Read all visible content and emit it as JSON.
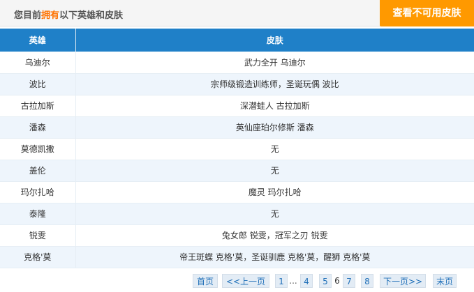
{
  "header": {
    "title_pre": "您目前",
    "title_highlight": "拥有",
    "title_post": "以下英雄和皮肤",
    "cta_label": "查看不可用皮肤"
  },
  "table": {
    "columns": [
      "英雄",
      "皮肤"
    ],
    "rows": [
      {
        "hero": "乌迪尔",
        "skins": "武力全开 乌迪尔"
      },
      {
        "hero": "波比",
        "skins": "宗师级锻造训练师，圣诞玩偶 波比"
      },
      {
        "hero": "古拉加斯",
        "skins": "深潜蛙人 古拉加斯"
      },
      {
        "hero": "潘森",
        "skins": "英仙座珀尔修斯 潘森"
      },
      {
        "hero": "莫德凯撒",
        "skins": "无"
      },
      {
        "hero": "盖伦",
        "skins": "无"
      },
      {
        "hero": "玛尔扎哈",
        "skins": "魔灵 玛尔扎哈"
      },
      {
        "hero": "泰隆",
        "skins": "无"
      },
      {
        "hero": "锐雯",
        "skins": "兔女郎 锐雯，冠军之刃 锐雯"
      },
      {
        "hero": "克格'莫",
        "skins": "帝王斑蝶 克格'莫，圣诞驯鹿 克格'莫，醒狮 克格'莫"
      }
    ]
  },
  "pagination": {
    "first": "首页",
    "prev": "<<上一页",
    "p1": "1",
    "ellipsis": "...",
    "p4": "4",
    "p5": "5",
    "current": "6",
    "p7": "7",
    "p8": "8",
    "next": "下一页>>",
    "last": "末页"
  }
}
